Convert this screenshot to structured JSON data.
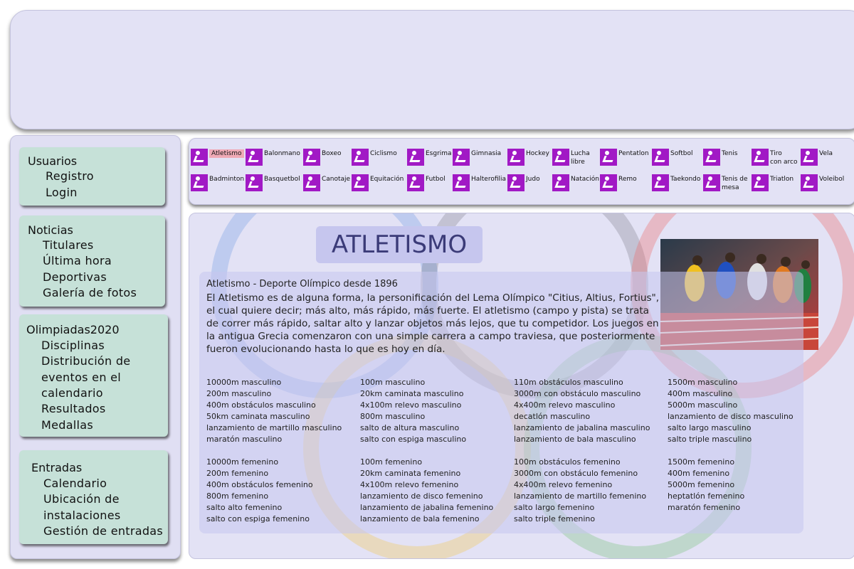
{
  "sidebar": {
    "usuarios": {
      "title": "Usuarios",
      "items": [
        "Registro",
        "Login"
      ]
    },
    "noticias": {
      "title": "Noticias",
      "items": [
        "Titulares",
        "Última hora",
        "Deportivas",
        "Galería de fotos"
      ]
    },
    "olimpiadas": {
      "title": "Olimpiadas2020",
      "items": [
        "Disciplinas",
        "Distribución de",
        "eventos en el",
        "calendario",
        "Resultados",
        "Medallas"
      ]
    },
    "entradas": {
      "title": "Entradas",
      "items": [
        "Calendario",
        "Ubicación de",
        "instalaciones",
        "Gestión de entradas"
      ]
    }
  },
  "disciplines_row1": [
    "Atletismo",
    "Balonmano",
    "Boxeo",
    "Ciclismo",
    "Esgrima",
    "Gimnasia",
    "Hockey",
    "Lucha\nlibre",
    "Pentatlon",
    "Softbol",
    "Tenis",
    "Tiro\ncon arco",
    "Vela"
  ],
  "disciplines_row2": [
    "Badminton",
    "Basquetbol",
    "Canotaje",
    "Equitación",
    "Futbol",
    "Halterofilia",
    "Judo",
    "Natación",
    "Remo",
    "Taekondo",
    "Tenis de\nmesa",
    "Triatlon",
    "Voleibol"
  ],
  "main": {
    "title": "ATLETISMO",
    "intro_heading": "Atletismo - Deporte Olímpico desde 1896",
    "intro_text": "El Atletismo es de alguna forma, la personificación del Lema Olímpico \"Citius, Altius, Fortius\", el cual quiere decir; más alto, más rápido, más fuerte. El atletismo (campo y pista) se trata de correr más rápido, saltar alto y lanzar objetos más lejos, que tu competidor. Los juegos en la antigua Grecia comenzaron con una simple carrera a campo traviesa, que posteriormente fueron evolucionando hasta lo que es hoy en día.",
    "male_events": [
      [
        "10000m masculino",
        "200m masculino",
        "400m obstáculos masculino",
        "50km caminata masculino",
        "lanzamiento de martillo masculino",
        "maratón masculino"
      ],
      [
        "100m masculino",
        "20km caminata masculino",
        "4x100m relevo masculino",
        "800m masculino",
        "salto de altura masculino",
        "salto con espiga masculino"
      ],
      [
        "110m obstáculos masculino",
        "3000m con obstáculo masculino",
        "4x400m relevo masculino",
        "decatlón masculino",
        "lanzamiento de jabalina masculino",
        "lanzamiento de bala masculino"
      ],
      [
        "1500m masculino",
        "400m masculino",
        "5000m masculino",
        "lanzamiento de disco masculino",
        "salto largo masculino",
        "salto triple masculino"
      ]
    ],
    "female_events": [
      [
        "10000m femenino",
        "200m femenino",
        "400m obstáculos femenino",
        "800m femenino",
        "salto alto femenino",
        "salto con espiga femenino"
      ],
      [
        "100m femenino",
        "20km caminata femenino",
        "4x100m relevo femenino",
        "lanzamiento de disco femenino",
        "lanzamiento de jabalina femenino",
        "lanzamiento de bala femenino"
      ],
      [
        "100m obstáculos femenino",
        "3000m con obstáculo femenino",
        "4x400m relevo femenino",
        "lanzamiento de martillo femenino",
        "salto largo femenino",
        "salto triple femenino"
      ],
      [
        "1500m femenino",
        "400m femenino",
        "5000m femenino",
        "heptatlón femenino",
        "maratón femenino"
      ]
    ]
  },
  "colors": {
    "icon": "#a119c5",
    "panel": "#e3e2f5",
    "menu": "#c6e1d8",
    "highlight": "#efaab6",
    "title": "#3b3b78"
  }
}
